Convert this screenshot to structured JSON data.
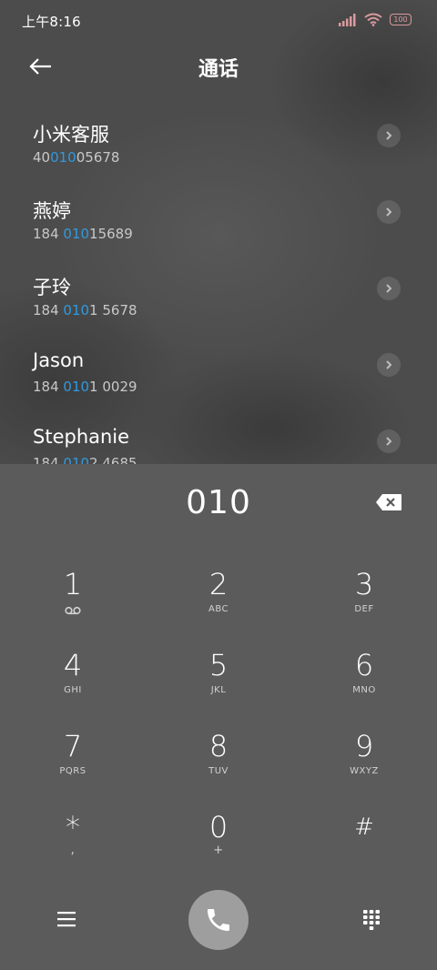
{
  "status": {
    "time": "上午8:16",
    "battery": "100"
  },
  "header": {
    "title": "通话"
  },
  "contacts": [
    {
      "name": "小米客服",
      "num_pre": "40",
      "num_hl": "010",
      "num_post": "05678"
    },
    {
      "name": "燕婷",
      "num_pre": "184 ",
      "num_hl": "010",
      "num_post": "15689"
    },
    {
      "name": "子玲",
      "num_pre": "184 ",
      "num_hl": "010",
      "num_post": "1 5678"
    },
    {
      "name": "Jason",
      "num_pre": "184 ",
      "num_hl": "010",
      "num_post": "1 0029"
    },
    {
      "name": "Stephanie",
      "num_pre": "184 ",
      "num_hl": "010",
      "num_post": "2 4685"
    }
  ],
  "dialpad": {
    "entered": "010",
    "keys": [
      {
        "digit": "1",
        "letters": ""
      },
      {
        "digit": "2",
        "letters": "ABC"
      },
      {
        "digit": "3",
        "letters": "DEF"
      },
      {
        "digit": "4",
        "letters": "GHI"
      },
      {
        "digit": "5",
        "letters": "JKL"
      },
      {
        "digit": "6",
        "letters": "MNO"
      },
      {
        "digit": "7",
        "letters": "PQRS"
      },
      {
        "digit": "8",
        "letters": "TUV"
      },
      {
        "digit": "9",
        "letters": "WXYZ"
      },
      {
        "digit": "*",
        "letters": ","
      },
      {
        "digit": "0",
        "letters": "+"
      },
      {
        "digit": "#",
        "letters": ""
      }
    ]
  },
  "icons": {
    "back": "back-arrow-icon",
    "chevron": "chevron-right-icon",
    "backspace": "backspace-icon",
    "voicemail": "voicemail-icon",
    "menu": "menu-icon",
    "call": "phone-icon",
    "keypad": "keypad-icon"
  },
  "colors": {
    "highlight": "#2f9ae0",
    "call_button": "#9e9e9e",
    "battery": "#d99a9e"
  }
}
